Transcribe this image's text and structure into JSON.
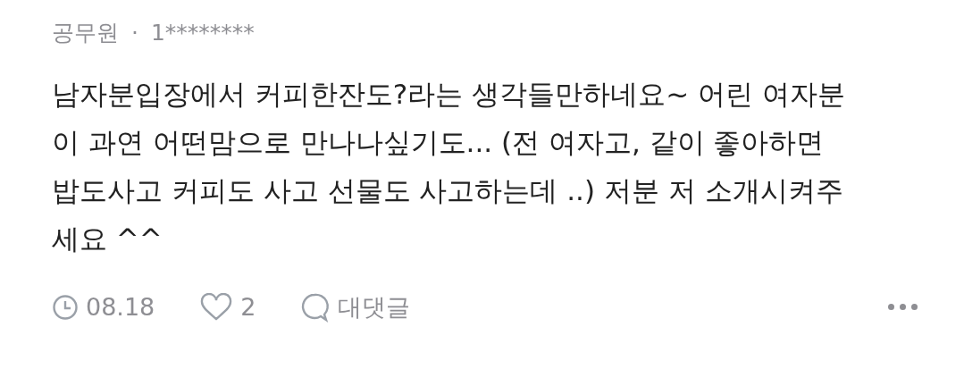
{
  "comment": {
    "author": "공무원",
    "separator": "·",
    "user_id": "1********",
    "body_lines": [
      "남자분입장에서 커피한잔도?라는 생각들만하네요~ 어린 여자분",
      "이 과연 어떤맘으로 만나나싶기도... (전 여자고, 같이 좋아하면",
      "밥도사고 커피도 사고 선물도 사고하는데 ..) 저분 저 소개시켜주",
      "세요 ^^"
    ],
    "date": "08.18",
    "likes": "2",
    "liked": false,
    "reply_label": "대댓글"
  }
}
